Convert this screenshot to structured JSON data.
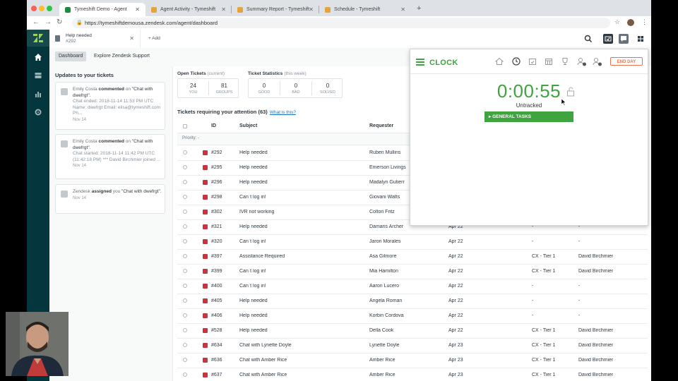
{
  "browser": {
    "tabs": [
      {
        "title": "Tymeshift Demo - Agent",
        "favicon_color": "#1f8a3e"
      },
      {
        "title": "Agent Activity - Tymeshift",
        "favicon_color": "#e8a23a"
      },
      {
        "title": "Summary Report - Tymeshift",
        "favicon_color": "#e8a23a"
      },
      {
        "title": "Schedule - Tymeshift",
        "favicon_color": "#e8a23a"
      }
    ],
    "url": "https://tymeshiftdemousa.zendesk.com/agent/dashboard"
  },
  "header": {
    "ticket_tab": {
      "title": "Help needed",
      "number": "#292"
    },
    "add_label": "+ Add"
  },
  "subnav": {
    "tabs": [
      "Dashboard",
      "Explore Zendesk Support"
    ]
  },
  "updates": {
    "title": "Updates to your tickets",
    "items": [
      {
        "who": "Emily Costa",
        "action": "commented",
        "on": "on",
        "subject": "\"Chat with dwefrgt\".",
        "body": "Chat ended: 2018-11-14 11:53 PM UTC Name: dwefrgt Email: elisa@tymeshift.com Ph...",
        "date": "Nov 14"
      },
      {
        "who": "Emily Costa",
        "action": "commented",
        "on": "on",
        "subject": "\"Chat with dwefrgt\".",
        "body": "Chat started: 2018-11-14 11:42 PM UTC (11:42:18 PM) *** David Birchmier joined ...",
        "date": "Nov 14"
      },
      {
        "who": "Zendesk",
        "action": "assigned",
        "on": "you",
        "subject": "\"Chat with dwefrgt\".",
        "body": "",
        "date": "Nov 14"
      }
    ]
  },
  "stats": {
    "open_label": "Open Tickets",
    "open_note": "(current)",
    "stat_label": "Ticket Statistics",
    "stat_note": "(this week)",
    "open": [
      {
        "n": "24",
        "l": "YOU"
      },
      {
        "n": "81",
        "l": "GROUPS"
      }
    ],
    "week": [
      {
        "n": "0",
        "l": "GOOD"
      },
      {
        "n": "0",
        "l": "BAD"
      },
      {
        "n": "0",
        "l": "SOLVED"
      }
    ]
  },
  "view": {
    "title": "Tickets requiring your attention (63)",
    "what_link": "What is this?",
    "columns": {
      "id": "ID",
      "subject": "Subject",
      "requester": "Requester"
    },
    "group_label": "Priority: -",
    "rows": [
      {
        "id": "#292",
        "subject": "Help needed",
        "requester": "Ruben Mullins",
        "date": "",
        "group": "",
        "assignee": ""
      },
      {
        "id": "#295",
        "subject": "Help needed",
        "requester": "Emerson Livings",
        "date": "",
        "group": "",
        "assignee": ""
      },
      {
        "id": "#296",
        "subject": "Help needed",
        "requester": "Madalyn Gutierr",
        "date": "",
        "group": "",
        "assignee": ""
      },
      {
        "id": "#298",
        "subject": "Can`t log in!",
        "requester": "Giovani Watts",
        "date": "",
        "group": "",
        "assignee": ""
      },
      {
        "id": "#302",
        "subject": "IVR not working",
        "requester": "Colton Fritz",
        "date": "",
        "group": "",
        "assignee": ""
      },
      {
        "id": "#321",
        "subject": "Help needed",
        "requester": "Damaris Archer",
        "date": "Apr 22",
        "group": "-",
        "assignee": "-"
      },
      {
        "id": "#320",
        "subject": "Can`t log in!",
        "requester": "Jaron Morales",
        "date": "Apr 22",
        "group": "-",
        "assignee": "-"
      },
      {
        "id": "#397",
        "subject": "Assistance Required",
        "requester": "Asa Gilmore",
        "date": "Apr 22",
        "group": "CX - Tier 1",
        "assignee": "David Birchmier"
      },
      {
        "id": "#399",
        "subject": "Can`t log in!",
        "requester": "Mia Hamilton",
        "date": "Apr 22",
        "group": "CX - Tier 1",
        "assignee": "David Birchmier"
      },
      {
        "id": "#400",
        "subject": "Can`t log in!",
        "requester": "Aaron Lucero",
        "date": "Apr 22",
        "group": "-",
        "assignee": "-"
      },
      {
        "id": "#405",
        "subject": "Help needed",
        "requester": "Angela Roman",
        "date": "Apr 22",
        "group": "-",
        "assignee": "-"
      },
      {
        "id": "#406",
        "subject": "Help needed",
        "requester": "Korbin Cordova",
        "date": "Apr 22",
        "group": "-",
        "assignee": "-"
      },
      {
        "id": "#528",
        "subject": "Help needed",
        "requester": "Della Cook",
        "date": "Apr 22",
        "group": "CX - Tier 1",
        "assignee": "David Birchmier"
      },
      {
        "id": "#634",
        "subject": "Chat with Lynette Doyle",
        "requester": "Lynette Doyle",
        "date": "Apr 23",
        "group": "CX - Tier 1",
        "assignee": "David Birchmier"
      },
      {
        "id": "#636",
        "subject": "Chat with Amber Rice",
        "requester": "Amber Rice",
        "date": "Apr 23",
        "group": "CX - Tier 1",
        "assignee": "David Birchmier"
      },
      {
        "id": "#637",
        "subject": "Chat with Amber Rice",
        "requester": "Amber Rice",
        "date": "Apr 23",
        "group": "CX - Tier 1",
        "assignee": "David Birchmier"
      }
    ]
  },
  "clock": {
    "title": "CLOCK",
    "end_day": "END DAY",
    "time": "0:00:55",
    "status": "Untracked",
    "task_button": "GENERAL TASKS",
    "accent": "#3fa33f",
    "end_color": "#e8734a"
  }
}
